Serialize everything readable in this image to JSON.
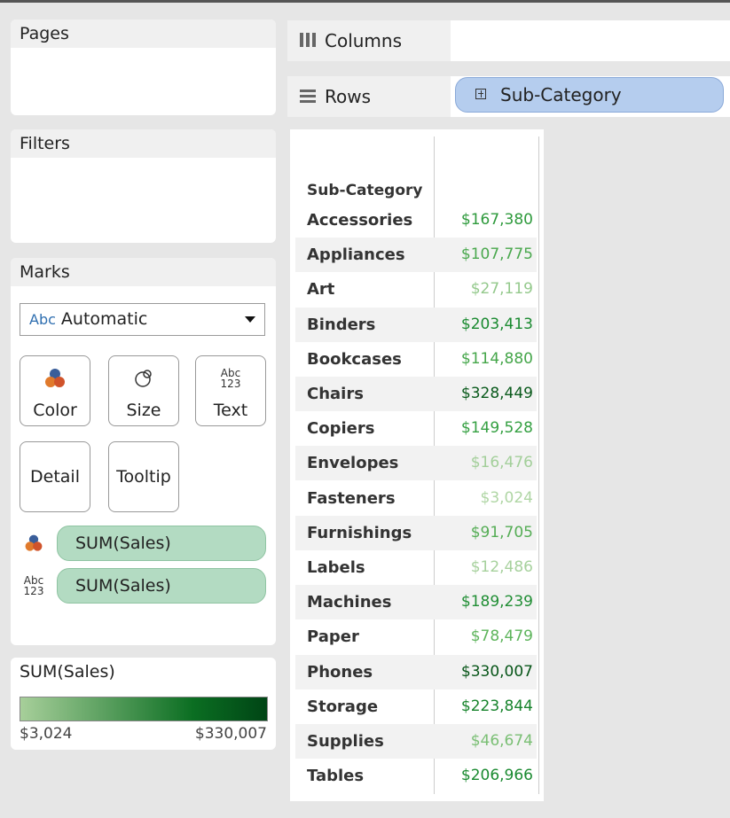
{
  "cards": {
    "pages": "Pages",
    "filters": "Filters",
    "marks": "Marks",
    "legend": "SUM(Sales)"
  },
  "marks": {
    "mark_type": "Automatic",
    "mark_type_icon_text": "Abc",
    "buttons": {
      "color": "Color",
      "size": "Size",
      "text": "Text",
      "detail": "Detail",
      "tooltip": "Tooltip"
    },
    "text_icon_line1": "Abc",
    "text_icon_line2": "123",
    "pills": [
      "SUM(Sales)",
      "SUM(Sales)"
    ]
  },
  "legend": {
    "min_label": "$3,024",
    "max_label": "$330,007",
    "colors": [
      "#a7cf9a",
      "#0b6e22",
      "#004515"
    ]
  },
  "shelves": {
    "columns": "Columns",
    "rows": "Rows",
    "row_pill": "Sub-Category"
  },
  "table": {
    "header": "Sub-Category",
    "rows": [
      {
        "category": "Accessories",
        "value": "$167,380",
        "color": "#2e9a3c"
      },
      {
        "category": "Appliances",
        "value": "$107,775",
        "color": "#4aa84e"
      },
      {
        "category": "Art",
        "value": "$27,119",
        "color": "#94c98c"
      },
      {
        "category": "Binders",
        "value": "$203,413",
        "color": "#1a8a30"
      },
      {
        "category": "Bookcases",
        "value": "$114,880",
        "color": "#45a64a"
      },
      {
        "category": "Chairs",
        "value": "$328,449",
        "color": "#0a5a1c"
      },
      {
        "category": "Copiers",
        "value": "$149,528",
        "color": "#35a042"
      },
      {
        "category": "Envelopes",
        "value": "$16,476",
        "color": "#a3cf9a"
      },
      {
        "category": "Fasteners",
        "value": "$3,024",
        "color": "#b0d6a5"
      },
      {
        "category": "Furnishings",
        "value": "$91,705",
        "color": "#55ad55"
      },
      {
        "category": "Labels",
        "value": "$12,486",
        "color": "#a7d19d"
      },
      {
        "category": "Machines",
        "value": "$189,239",
        "color": "#208e34"
      },
      {
        "category": "Paper",
        "value": "$78,479",
        "color": "#5db45b"
      },
      {
        "category": "Phones",
        "value": "$330,007",
        "color": "#075518"
      },
      {
        "category": "Storage",
        "value": "$223,844",
        "color": "#17842c"
      },
      {
        "category": "Supplies",
        "value": "$46,674",
        "color": "#7abf74"
      },
      {
        "category": "Tables",
        "value": "$206,966",
        "color": "#1a8a30"
      }
    ]
  }
}
